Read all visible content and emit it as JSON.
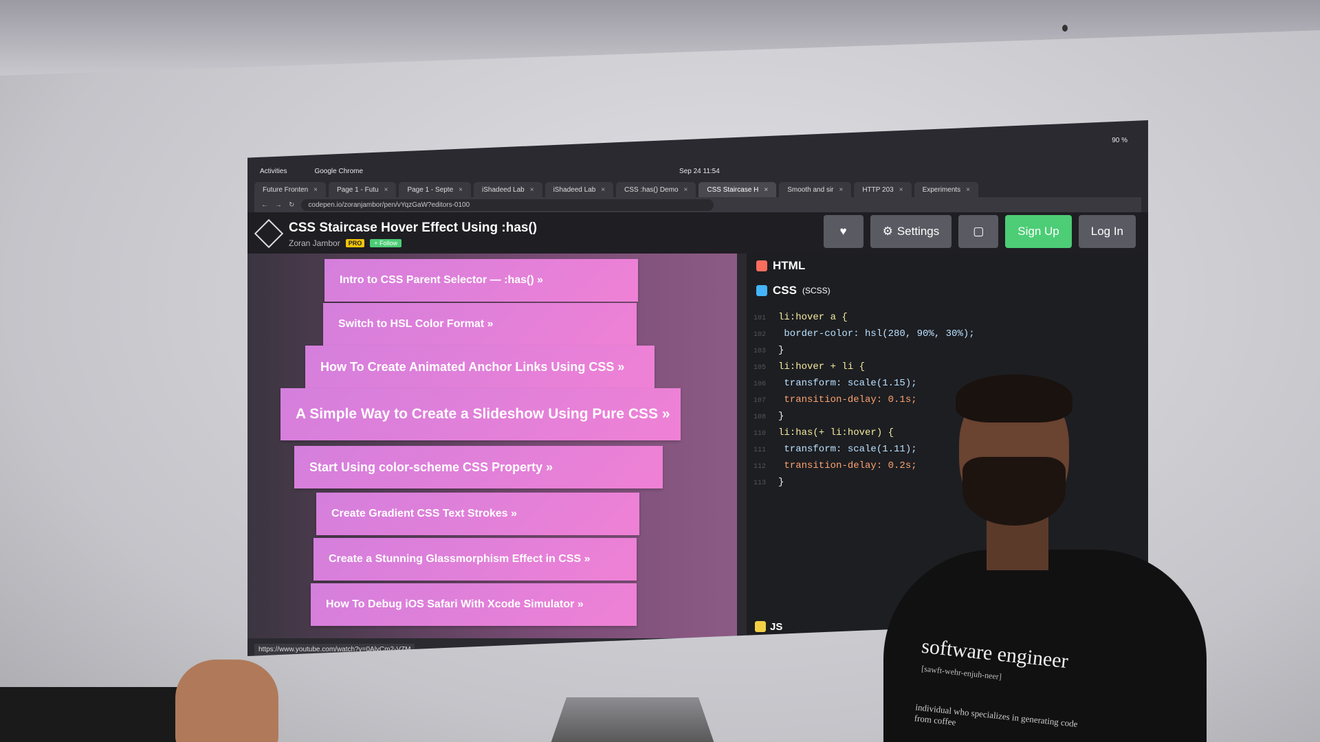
{
  "os_bar": {
    "activities": "Activities",
    "app": "Google Chrome",
    "clock": "Sep 24 11:54",
    "battery": "90 %"
  },
  "browser": {
    "tabs": [
      {
        "label": "Future Fronten"
      },
      {
        "label": "Page 1 - Futu"
      },
      {
        "label": "Page 1 - Septe"
      },
      {
        "label": "iShadeed Lab"
      },
      {
        "label": "iShadeed Lab"
      },
      {
        "label": "CSS :has() Demo"
      },
      {
        "label": "CSS Staircase H"
      },
      {
        "label": "Smooth and sir"
      },
      {
        "label": "HTTP 203"
      },
      {
        "label": "Experiments"
      }
    ],
    "url": "codepen.io/zoranjambor/pen/vYqzGaW?editors-0100"
  },
  "pen": {
    "title": "CSS Staircase Hover Effect Using :has()",
    "author": "Zoran Jambor",
    "pro": "PRO",
    "follow": "+ Follow",
    "buttons": {
      "settings": "Settings",
      "signup": "Sign Up",
      "login": "Log In"
    }
  },
  "preview": {
    "items": [
      "Intro to CSS Parent Selector — :has() »",
      "Switch to HSL Color Format »",
      "How To Create Animated Anchor Links Using CSS »",
      "A Simple Way to Create a Slideshow Using Pure CSS »",
      "Start Using color-scheme CSS Property »",
      "Create Gradient CSS Text Strokes »",
      "Create a Stunning Glassmorphism Effect in CSS »",
      "How To Debug iOS Safari With Xcode Simulator »"
    ]
  },
  "editor": {
    "html_label": "HTML",
    "css_label": "CSS",
    "css_sub": "(SCSS)",
    "js_label": "JS",
    "code": [
      "li:hover a {",
      "  border-color: hsl(280, 90%, 30%);",
      "}",
      "li:hover + li {",
      "  transform: scale(1.15);",
      "  transition-delay: 0.1s;",
      "}",
      "li:has(+ li:hover) {",
      "  transform: scale(1.11);",
      "  transition-delay: 0.2s;",
      "}"
    ]
  },
  "status_url": "https://www.youtube.com/watch?v=0AlyCm2-VZM",
  "shirt": {
    "title": "software engineer",
    "phonetic": "[sawft-wehr-enjuh-neer]",
    "definition": "individual who specializes in generating code from coffee"
  }
}
